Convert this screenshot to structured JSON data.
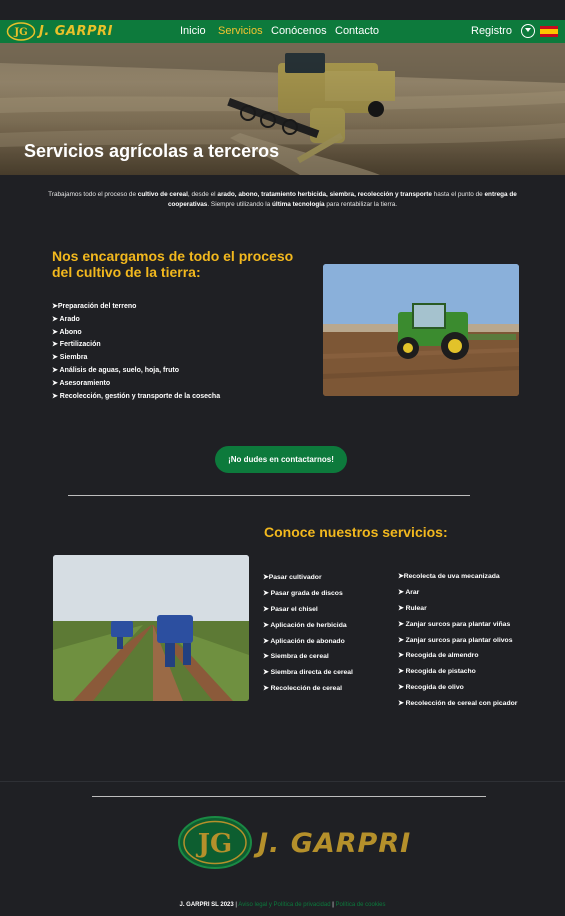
{
  "brand": {
    "name": "J. GARPRI",
    "monogram": "JG"
  },
  "nav": {
    "inicio": "Inicio",
    "servicios": "Servicios",
    "conocenos": "Conócenos",
    "contacto": "Contacto",
    "registro": "Registro",
    "accent": "#f4c430",
    "bg": "#0d7a3c"
  },
  "hero": {
    "title": "Servicios agrícolas a terceros"
  },
  "intro": {
    "p1": "Trabajamos todo el proceso de ",
    "b1": "cultivo de cereal",
    "p2": ", desde el ",
    "b2": "arado, abono, tratamiento herbicida, siembra, recolección y transporte",
    "p3": " hasta el punto de ",
    "b3": "entrega de cooperativas",
    "p4": ". Siempre utilizando la ",
    "b4": "última tecnología",
    "p5": " para rentabilizar la tierra."
  },
  "process": {
    "title": "Nos encargamos de todo el proceso del cultivo de la tierra:",
    "items": [
      "➤Preparación del terreno",
      "➤ Arado",
      "➤ Abono",
      "➤ Fertilización",
      "➤ Siembra",
      "➤ Análisis de aguas, suelo, hoja, fruto",
      "➤ Asesoramiento",
      "➤ Recolección, gestión y transporte de la cosecha"
    ]
  },
  "cta": {
    "label": "¡No dudes en contactarnos!"
  },
  "services": {
    "title": "Conoce nuestros servicios:",
    "col1": [
      "➤Pasar cultivador",
      "➤ Pasar grada de discos",
      "➤ Pasar el chisel",
      "➤ Aplicación de herbicida",
      "➤ Aplicación de abonado",
      "➤ Siembra de cereal",
      "➤ Siembra directa de cereal",
      "➤ Recolección de cereal"
    ],
    "col2": [
      "➤Recolecta de uva mecanizada",
      "➤ Arar",
      "➤ Rulear",
      "➤ Zanjar surcos para plantar viñas",
      "➤ Zanjar surcos para plantar olivos",
      "➤ Recogida de almendro",
      "➤ Recogida de pistacho",
      "➤ Recogida de olivo",
      "➤ Recolección de cereal con picador"
    ]
  },
  "footer": {
    "copyright": "J. GARPRI SL 2023",
    "sep": " | ",
    "legal": "Aviso legal y Política de privacidad",
    "cookies": "Política de cookies"
  },
  "colors": {
    "green": "#0d7a3c",
    "gold": "#f2b81e",
    "background": "#1f2024"
  }
}
